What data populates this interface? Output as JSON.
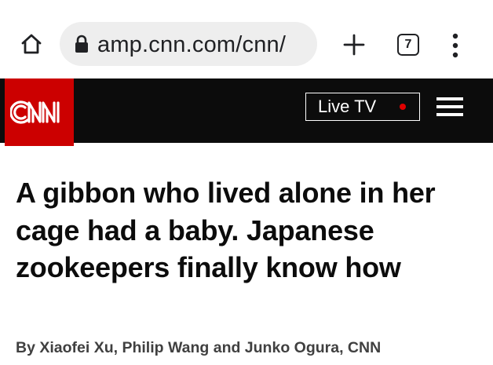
{
  "browser": {
    "url": "amp.cnn.com/cnn/",
    "tab_count": "7",
    "icons": [
      "home-icon",
      "lock-icon",
      "plus-icon",
      "tabs-icon",
      "more-vert-icon"
    ]
  },
  "site_header": {
    "logo": "CNN",
    "live_tv_label": "Live TV",
    "colors": {
      "brand_red": "#cc0000",
      "header_bg": "#0c0c0c",
      "live_dot": "#e00000"
    }
  },
  "article": {
    "headline": "A gibbon who lived alone in her cage had a baby. Japanese zookeepers finally know how",
    "byline": "By Xiaofei Xu, Philip Wang and Junko Ogura, CNN"
  }
}
